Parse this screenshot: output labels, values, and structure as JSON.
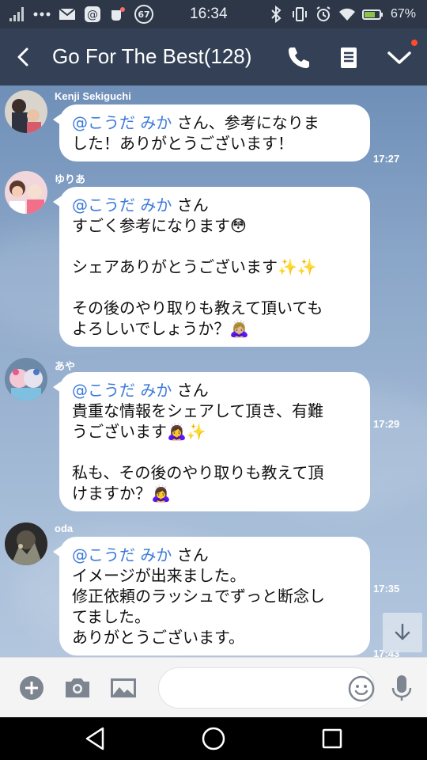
{
  "status_bar": {
    "time": "16:34",
    "battery": "67%",
    "badge_count": "67",
    "icons": [
      "signal-icon",
      "more-dots-icon",
      "mail-icon",
      "at-icon",
      "cup-icon",
      "bluetooth-icon",
      "vibrate-icon",
      "alarm-icon",
      "wifi-icon",
      "battery-icon"
    ]
  },
  "header": {
    "title": "Go For The Best(128)",
    "icons": [
      "back-icon",
      "phone-icon",
      "note-icon",
      "chevron-down-icon"
    ],
    "accent": "#334056",
    "notification_dot_color": "#ff4b2b"
  },
  "messages": [
    {
      "sender": "Kenji Sekiguchi",
      "mention": "@こうだ みか",
      "lines": [
        "@こうだ みか さん、参考になりま",
        "した！ありがとうございます！"
      ],
      "time": "17:27"
    },
    {
      "sender": "ゆりあ",
      "mention": "@こうだ みか",
      "lines": [
        "@こうだ みか さん",
        "すごく参考になります😳",
        "",
        "シェアありがとうございます✨✨",
        "",
        "その後のやり取りも教えて頂いても",
        "よろしいでしょうか？🙇🏼‍♀️"
      ],
      "time": "17:29"
    },
    {
      "sender": "あや",
      "mention": "@こうだ みか",
      "lines": [
        "@こうだ みか さん",
        "貴重な情報をシェアして頂き、有難",
        "うございます🙇‍♀️✨",
        "",
        "私も、その後のやり取りも教えて頂",
        "けますか？🙇‍♀️"
      ],
      "time": "17:35"
    },
    {
      "sender": "oda",
      "mention": "@こうだ みか",
      "lines": [
        "@こうだ みか さん",
        "イメージが出来ました。",
        "修正依頼のラッシュでずっと断念し",
        "てました。",
        "ありがとうございます。"
      ],
      "time": "17:43"
    }
  ],
  "chat": {
    "mention_color": "#3d7bd9",
    "scroll_button_icon": "arrow-down-icon"
  },
  "input_bar": {
    "icons": [
      "plus-icon",
      "camera-icon",
      "image-icon",
      "emoji-icon",
      "microphone-icon"
    ],
    "placeholder": ""
  },
  "nav_bar": {
    "icons": [
      "back-triangle-icon",
      "home-circle-icon",
      "recents-square-icon"
    ]
  }
}
